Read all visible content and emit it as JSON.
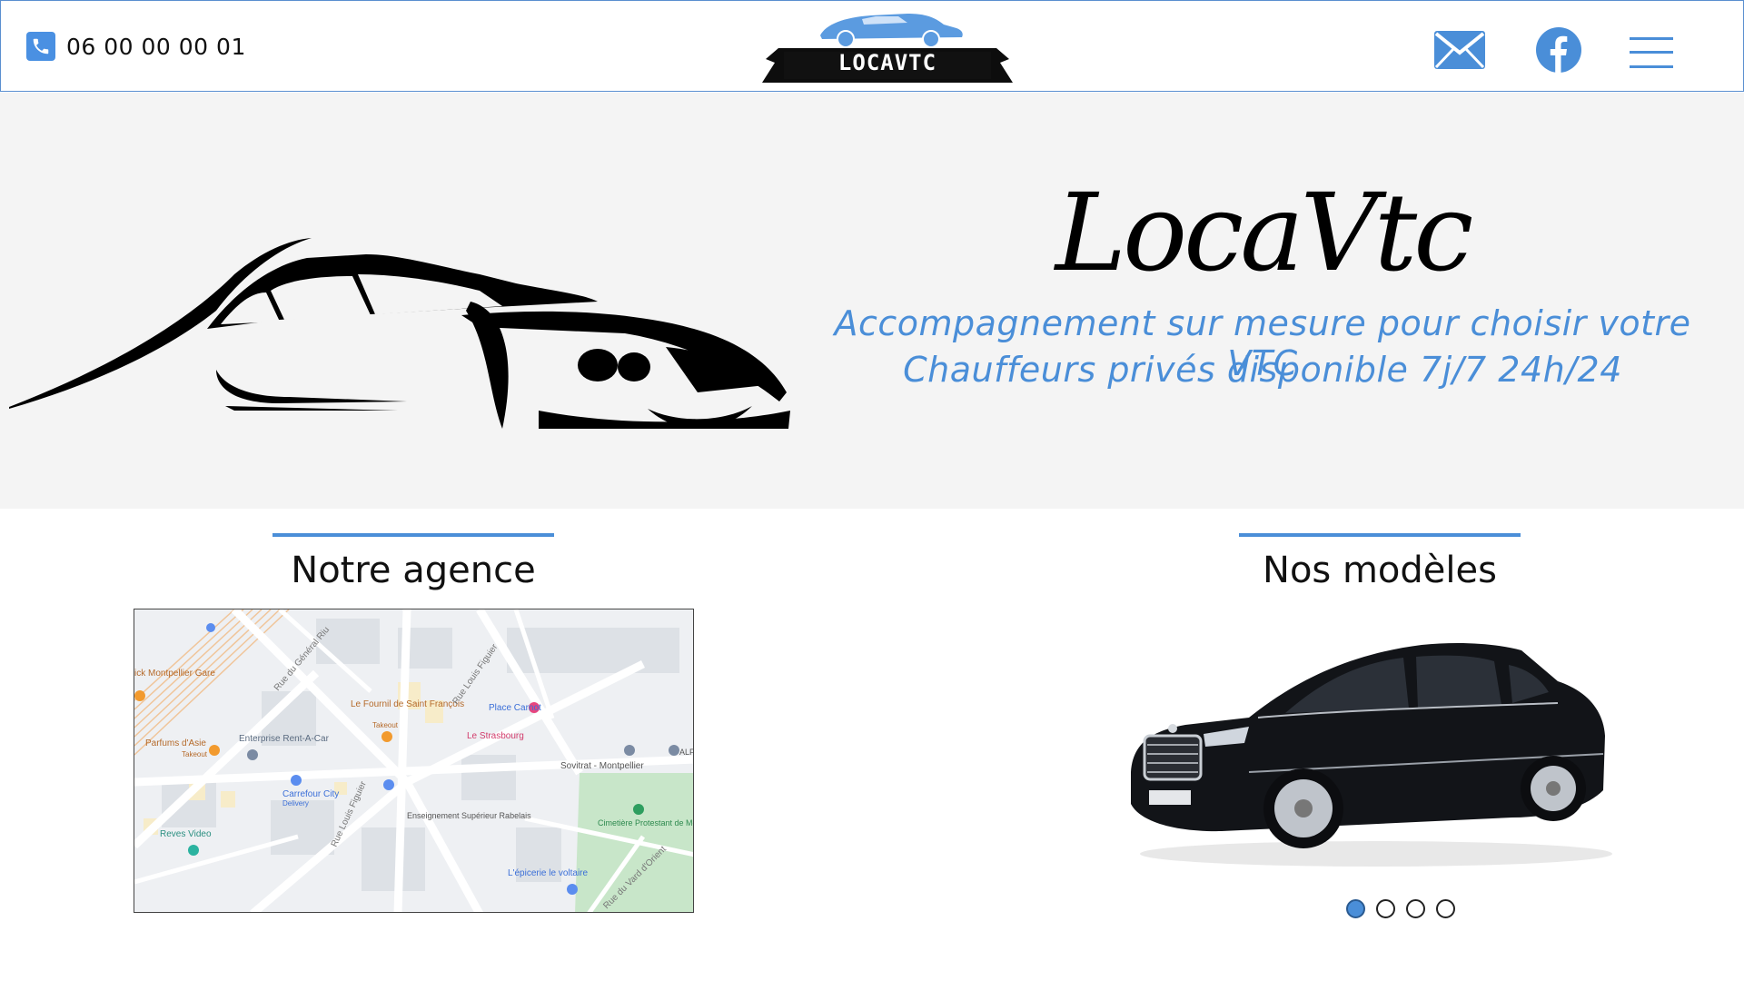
{
  "header": {
    "phone_icon": "phone-icon",
    "phone_number": "06 00 00 00 01",
    "logo_text": "LOCAVTC",
    "icons": [
      "mail-icon",
      "facebook-icon",
      "hamburger-menu-icon"
    ]
  },
  "hero": {
    "title": "LocaVtc",
    "subtitle_line1": "Accompagnement sur mesure pour choisir votre VTC",
    "subtitle_line2": "Chauffeurs privés disponible 7j/7 24h/24"
  },
  "sections": {
    "agency_title": "Notre agence",
    "models_title": "Nos modèles"
  },
  "map": {
    "labels": [
      "ick Montpellier Gare",
      "Rue du Général Riu",
      "Le Fournil de Saint François",
      "Takeout",
      "Rue Louis Figuier",
      "Place Carnot",
      "Le Strasbourg",
      "Parfums d'Asie",
      "Takeout",
      "Enterprise Rent-A-Car",
      "Sovitrat - Montpellier",
      "ALF Inte",
      "Carrefour City",
      "Delivery",
      "Enseignement Supérieur Rabelais",
      "Rue Louis Figuier",
      "Cimetière Protestant de Montpellier",
      "Reves Video",
      "L'épicerie le voltaire",
      "Rue du Vard d'Orient"
    ]
  },
  "carousel": {
    "slide_count": 4,
    "active_index": 0
  },
  "colors": {
    "accent": "#4a8ed8",
    "hero_bg": "#f4f4f4",
    "header_border": "#5a8fd0"
  }
}
